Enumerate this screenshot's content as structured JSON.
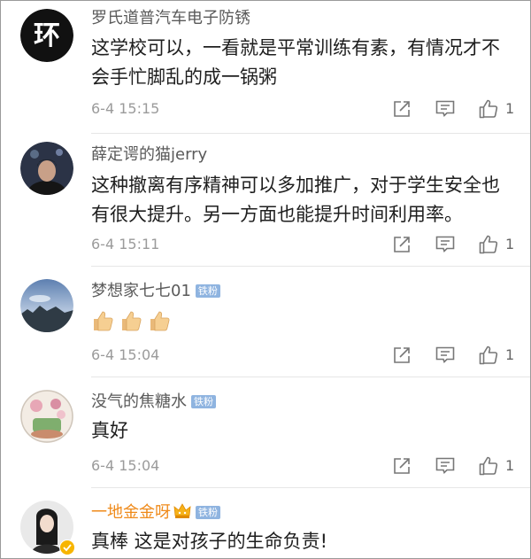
{
  "comments": [
    {
      "username": "罗氏道普汽车电子防锈",
      "text": "这学校可以，一看就是平常训练有素，有情况才不会手忙脚乱的成一锅粥",
      "time": "6-4 15:15",
      "likes": "1",
      "avatar_logo": "环"
    },
    {
      "username": "薛定谔的猫jerry",
      "text": "这种撤离有序精神可以多加推广，对于学生安全也有很大提升。另一方面也能提升时间利用率。",
      "time": "6-4 15:11",
      "likes": "1"
    },
    {
      "username": "梦想家七七01",
      "badge": "铁粉",
      "emojis": [
        "thumbs-up-emoji",
        "thumbs-up-emoji",
        "thumbs-up-emoji"
      ],
      "time": "6-4 15:04",
      "likes": "1"
    },
    {
      "username": "没气的焦糖水",
      "badge": "铁粉",
      "text": "真好",
      "time": "6-4 15:04",
      "likes": "1"
    },
    {
      "username": "一地金金呀",
      "badge": "铁粉",
      "text": "真棒 这是对孩子的生命负责!",
      "username_color": "#ef8a1a"
    }
  ],
  "icons": [
    "share-icon",
    "comment-icon",
    "like-icon",
    "crown-icon",
    "verified-icon"
  ]
}
